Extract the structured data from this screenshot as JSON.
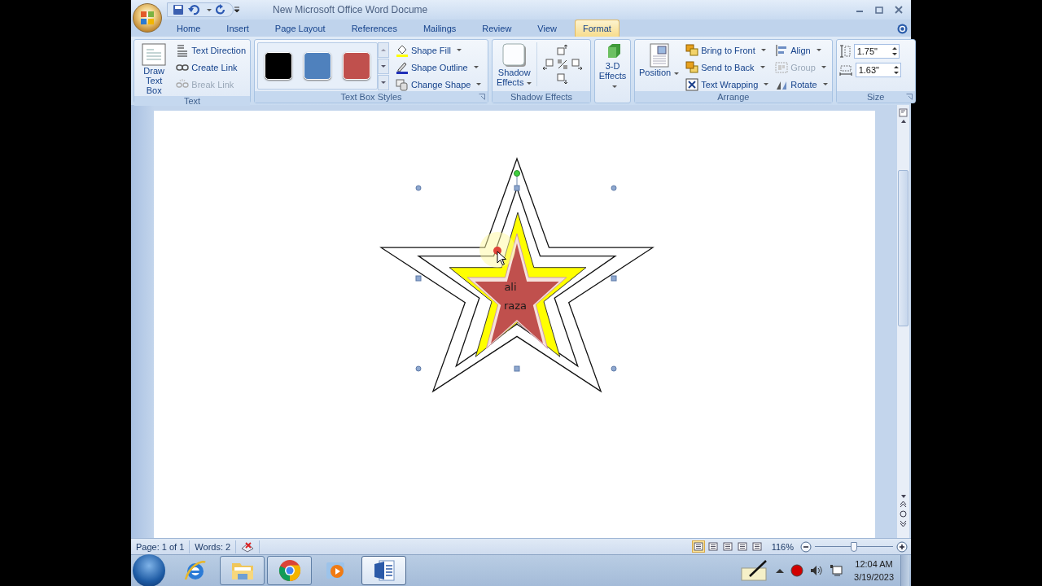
{
  "window": {
    "title": "New Microsoft Office Word Docume"
  },
  "tabs": [
    {
      "label": "Home",
      "selected": false
    },
    {
      "label": "Insert",
      "selected": false
    },
    {
      "label": "Page Layout",
      "selected": false
    },
    {
      "label": "References",
      "selected": false
    },
    {
      "label": "Mailings",
      "selected": false
    },
    {
      "label": "Review",
      "selected": false
    },
    {
      "label": "View",
      "selected": false
    },
    {
      "label": "Format",
      "selected": true
    }
  ],
  "ribbon": {
    "text": {
      "title": "Text",
      "large": {
        "lines": [
          "Draw",
          "Text Box"
        ]
      },
      "commands": [
        {
          "label": "Text Direction",
          "disabled": false
        },
        {
          "label": "Create Link",
          "disabled": false
        },
        {
          "label": "Break Link",
          "disabled": true
        }
      ]
    },
    "text_box_styles": {
      "title": "Text Box Styles",
      "swatches": [
        {
          "color": "#000000"
        },
        {
          "color": "#4f81bd"
        },
        {
          "color": "#c0504d"
        }
      ],
      "commands": [
        {
          "label": "Shape Fill"
        },
        {
          "label": "Shape Outline"
        },
        {
          "label": "Change Shape"
        }
      ]
    },
    "shadow_effects": {
      "title": "Shadow Effects",
      "large": {
        "lines": [
          "Shadow",
          "Effects"
        ]
      }
    },
    "three_d": {
      "large": {
        "lines": [
          "3-D",
          "Effects"
        ]
      }
    },
    "arrange": {
      "title": "Arrange",
      "large": {
        "lines": [
          "Position"
        ]
      },
      "commands": [
        {
          "label": "Bring to Front",
          "disabled": false
        },
        {
          "label": "Send to Back",
          "disabled": false
        },
        {
          "label": "Text Wrapping",
          "disabled": false
        },
        {
          "label": "Align",
          "disabled": false
        },
        {
          "label": "Group",
          "disabled": true
        },
        {
          "label": "Rotate",
          "disabled": false
        }
      ]
    },
    "size": {
      "title": "Size",
      "fields": [
        {
          "value": "1.75\""
        },
        {
          "value": "1.63\""
        }
      ]
    }
  },
  "document": {
    "shape_text": [
      "ali",
      "raza"
    ]
  },
  "status_bar": {
    "page": "Page: 1 of 1",
    "words": "Words: 2",
    "views": [
      {
        "selected": true
      },
      {
        "selected": false
      },
      {
        "selected": false
      },
      {
        "selected": false
      },
      {
        "selected": false
      }
    ],
    "zoom": "116%",
    "zoom_slider": {
      "level": 0.5
    }
  },
  "taskbar": {
    "apps": [
      {
        "kind": "ie",
        "open": false,
        "selected": false
      },
      {
        "kind": "explorer",
        "open": true,
        "selected": false
      },
      {
        "kind": "chrome",
        "open": true,
        "selected": false
      },
      {
        "kind": "media",
        "open": false,
        "selected": false
      },
      {
        "kind": "word",
        "open": true,
        "selected": true
      }
    ],
    "clock": {
      "time": "12:04 AM",
      "date": "3/19/2023"
    }
  }
}
